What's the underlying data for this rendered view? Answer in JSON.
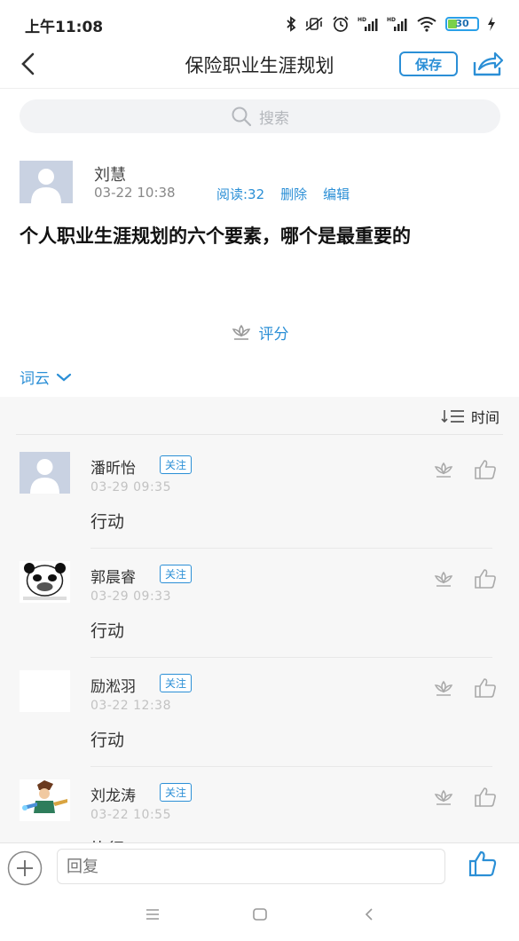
{
  "status_bar": {
    "time": "上午11:08",
    "battery": "30"
  },
  "nav": {
    "title": "保险职业生涯规划",
    "save_label": "保存"
  },
  "search": {
    "placeholder": "搜索"
  },
  "post": {
    "author": "刘慧",
    "time": "03-22 10:38",
    "reads": "阅读:32",
    "delete_label": "删除",
    "edit_label": "编辑",
    "title": "个人职业生涯规划的六个要素，哪个是最重要的"
  },
  "rate_label": "评分",
  "wordcloud_label": "词云",
  "sort_label": "时间",
  "comments": [
    {
      "name": "潘昕怡",
      "follow": "关注",
      "time": "03-29 09:35",
      "text": "行动"
    },
    {
      "name": "郭晨睿",
      "follow": "关注",
      "time": "03-29 09:33",
      "text": "行动"
    },
    {
      "name": "励淞羽",
      "follow": "关注",
      "time": "03-22 12:38",
      "text": "行动"
    },
    {
      "name": "刘龙涛",
      "follow": "关注",
      "time": "03-22 10:55",
      "text": "执行"
    }
  ],
  "reply": {
    "placeholder": "回复"
  },
  "colors": {
    "accent": "#2b8fd6",
    "background": "#f7f7f7"
  }
}
